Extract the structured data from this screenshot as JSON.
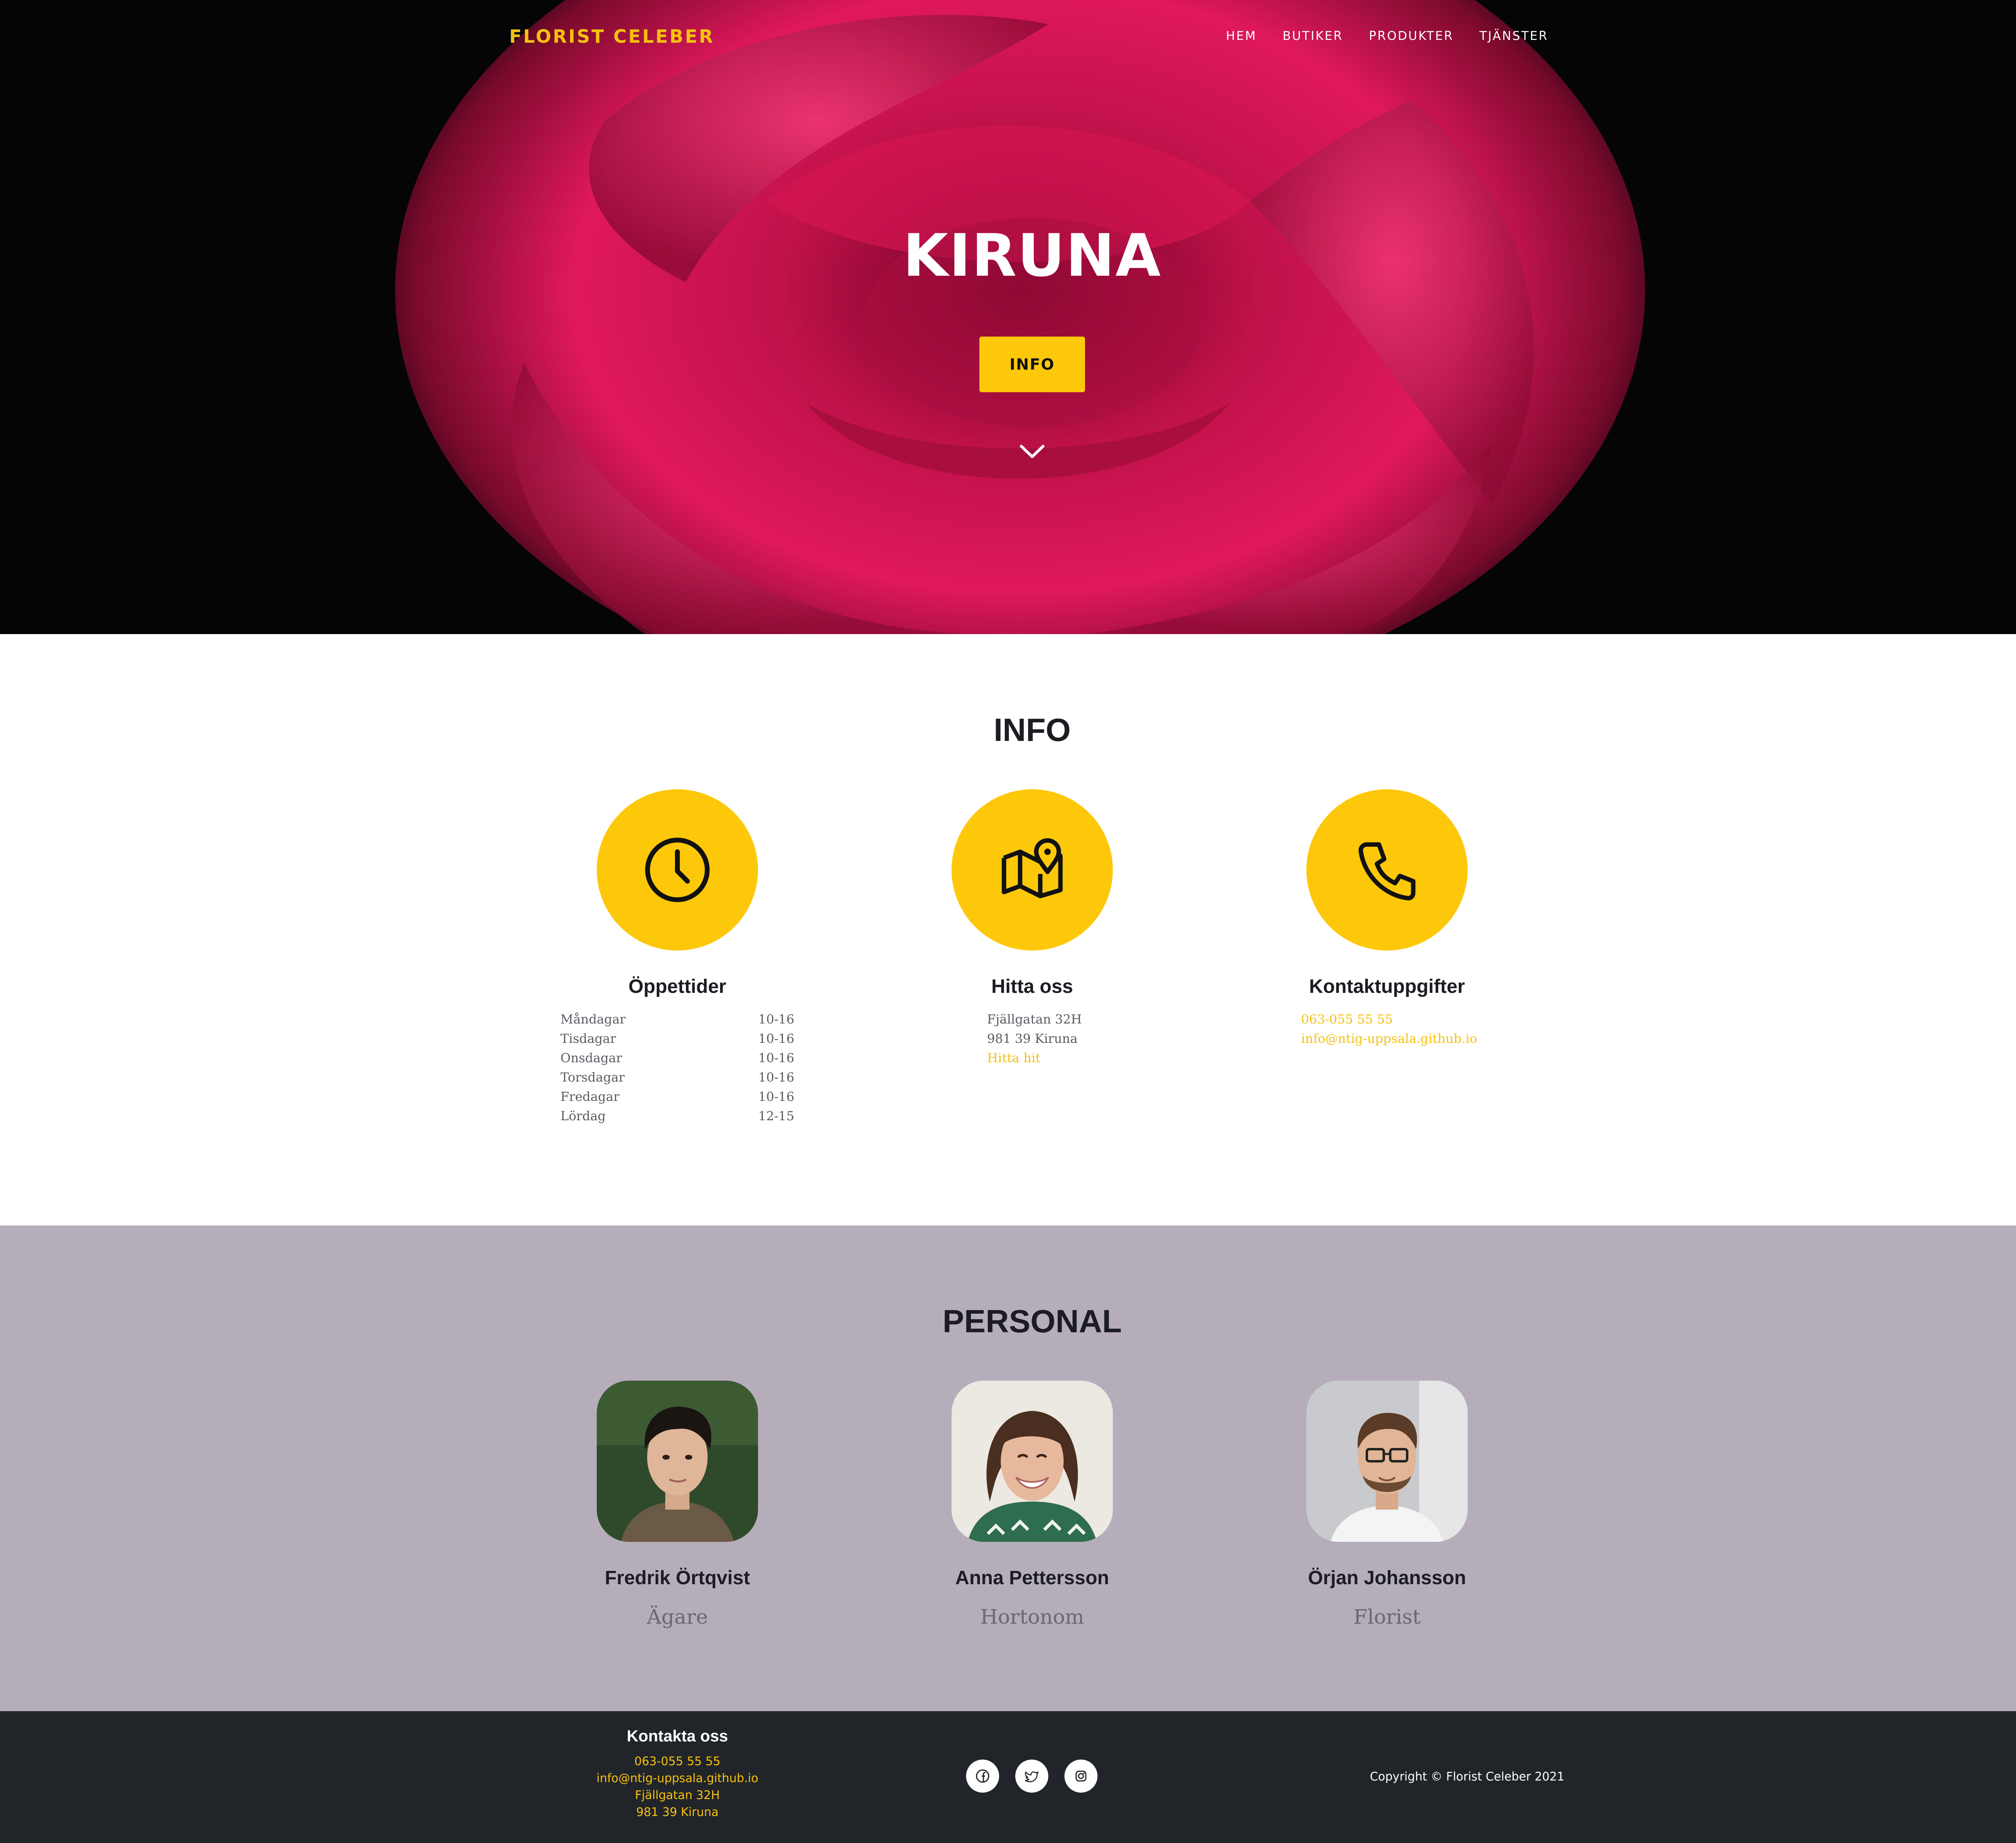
{
  "header": {
    "brand": "FLORIST CELEBER",
    "nav": [
      "HEM",
      "BUTIKER",
      "PRODUKTER",
      "TJÄNSTER"
    ]
  },
  "hero": {
    "title": "KIRUNA",
    "button_label": "INFO",
    "scroll_icon": "chevron-down-icon"
  },
  "info": {
    "title": "INFO",
    "hours": {
      "title": "Öppettider",
      "icon": "clock-icon",
      "rows": [
        {
          "day": "Måndagar",
          "time": "10-16"
        },
        {
          "day": "Tisdagar",
          "time": "10-16"
        },
        {
          "day": "Onsdagar",
          "time": "10-16"
        },
        {
          "day": "Torsdagar",
          "time": "10-16"
        },
        {
          "day": "Fredagar",
          "time": "10-16"
        },
        {
          "day": "Lördag",
          "time": "12-15"
        }
      ]
    },
    "find": {
      "title": "Hitta oss",
      "icon": "map-pin-icon",
      "street": "Fjällgatan 32H",
      "city": "981 39 Kiruna",
      "link": "Hitta hit"
    },
    "contact": {
      "title": "Kontaktuppgifter",
      "icon": "phone-icon",
      "phone": "063-055 55 55",
      "email": "info@ntig-uppsala.github.io"
    }
  },
  "staff": {
    "title": "PERSONAL",
    "members": [
      {
        "name": "Fredrik Örtqvist",
        "role": "Ägare"
      },
      {
        "name": "Anna Pettersson",
        "role": "Hortonom"
      },
      {
        "name": "Örjan Johansson",
        "role": "Florist"
      }
    ]
  },
  "footer": {
    "contact_title": "Kontakta oss",
    "phone": "063-055 55 55",
    "email": "info@ntig-uppsala.github.io",
    "street": "Fjällgatan 32H",
    "city": "981 39 Kiruna",
    "socials": [
      "facebook-icon",
      "twitter-icon",
      "instagram-icon"
    ],
    "copyright": "Copyright © Florist Celeber 2021"
  },
  "colors": {
    "accent": "#fec80a",
    "footer_bg": "#212529",
    "staff_bg": "#b5aeba"
  }
}
